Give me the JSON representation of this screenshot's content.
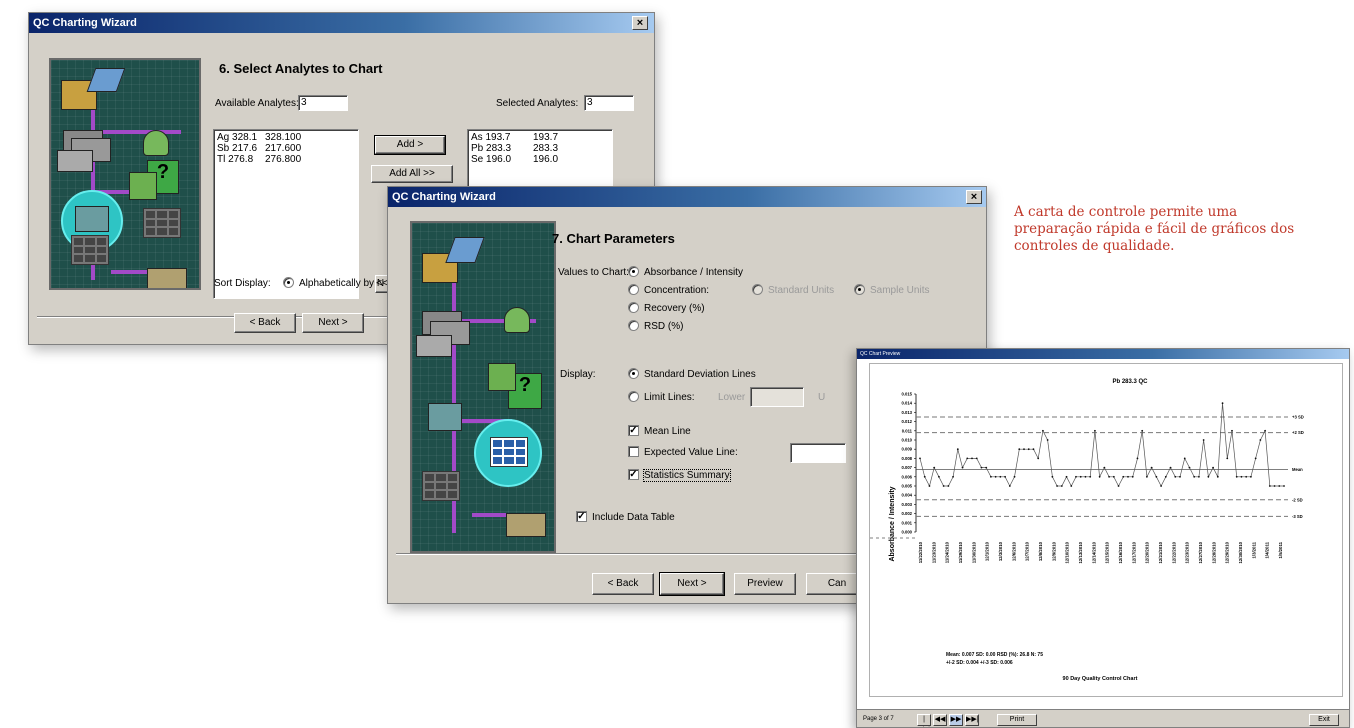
{
  "caption": "A carta de controle permite uma preparação rápida e fácil de gráficos dos controles de qualidade.",
  "wizard1": {
    "title": "QC Charting Wizard",
    "close": "×",
    "heading": "6. Select Analytes to Chart",
    "available_label": "Available Analytes:",
    "available_count": "3",
    "selected_label": "Selected Analytes:",
    "selected_count": "3",
    "available": [
      {
        "name": "Ag 328.1",
        "value": "328.100"
      },
      {
        "name": "Sb 217.6",
        "value": "217.600"
      },
      {
        "name": "Tl 276.8",
        "value": "276.800"
      }
    ],
    "selected": [
      {
        "name": "As 193.7",
        "value": "193.7"
      },
      {
        "name": "Pb 283.3",
        "value": "283.3"
      },
      {
        "name": "Se 196.0",
        "value": "196.0"
      }
    ],
    "add": "Add >",
    "add_all": "Add All >>",
    "remove_partial": "<<",
    "sort_label": "Sort Display:",
    "sort_option": "Alphabetically by N",
    "back": "< Back",
    "next": "Next >"
  },
  "wizard2": {
    "title": "QC Charting Wizard",
    "close": "×",
    "heading": "7. Chart Parameters",
    "values_label": "Values to Chart:",
    "opt_absorbance": "Absorbance / Intensity",
    "opt_concentration": "Concentration:",
    "opt_standard_units": "Standard Units",
    "opt_sample_units": "Sample Units",
    "opt_recovery": "Recovery (%)",
    "opt_rsd": "RSD (%)",
    "display_label": "Display:",
    "opt_std_dev": "Standard Deviation Lines",
    "opt_limit": "Limit Lines:",
    "lower": "Lower",
    "upper_partial": "U",
    "mean_line": "Mean Line",
    "expected_value": "Expected Value Line:",
    "stats_summary": "Statistics Summary",
    "include_table": "Include Data Table",
    "back": "< Back",
    "next": "Next >",
    "preview": "Preview",
    "cancel_partial": "Can"
  },
  "chart_preview": {
    "window_title": "QC Chart Preview",
    "page": "Page 3 of 7",
    "print": "Print",
    "exit": "Exit",
    "nav": [
      "|◀◀",
      "◀◀",
      "▶▶",
      "▶▶|"
    ]
  },
  "chart_data": {
    "type": "line",
    "title": "Pb 283.3  QC",
    "ylabel": "Absorbance / Intensity",
    "xlabel": "",
    "ylim": [
      0,
      0.015
    ],
    "yticks": [
      "0.015",
      "0.014",
      "0.013",
      "0.012",
      "0.011",
      "0.010",
      "0.009",
      "0.008",
      "0.007",
      "0.006",
      "0.005",
      "0.004",
      "0.003",
      "0.002",
      "0.001",
      "0.000"
    ],
    "reference_lines": [
      {
        "label": "+3 SD",
        "value": 0.0125
      },
      {
        "label": "+2 SD",
        "value": 0.0108
      },
      {
        "label": "Mean",
        "value": 0.0068
      },
      {
        "label": "-2 SD",
        "value": 0.0035
      },
      {
        "label": "-3 SD",
        "value": 0.0017
      }
    ],
    "x_labels": [
      "11/22/2010",
      "11/23/2010",
      "11/24/2010",
      "11/29/2010",
      "11/30/2010",
      "12/1/2010",
      "12/3/2010",
      "12/6/2010",
      "12/7/2010",
      "12/8/2010",
      "12/9/2010",
      "12/10/2010",
      "12/13/2010",
      "12/14/2010",
      "12/15/2010",
      "12/16/2010",
      "12/17/2010",
      "12/20/2010",
      "12/21/2010",
      "12/22/2010",
      "12/23/2010",
      "12/27/2010",
      "12/28/2010",
      "12/29/2010",
      "12/30/2010",
      "1/3/2011",
      "1/4/2011",
      "1/5/2011"
    ],
    "values": [
      0.008,
      0.006,
      0.005,
      0.007,
      0.006,
      0.005,
      0.005,
      0.006,
      0.009,
      0.007,
      0.008,
      0.008,
      0.008,
      0.007,
      0.007,
      0.006,
      0.006,
      0.006,
      0.006,
      0.005,
      0.006,
      0.009,
      0.009,
      0.009,
      0.009,
      0.008,
      0.011,
      0.01,
      0.006,
      0.005,
      0.005,
      0.006,
      0.005,
      0.006,
      0.006,
      0.006,
      0.006,
      0.011,
      0.006,
      0.007,
      0.006,
      0.006,
      0.005,
      0.006,
      0.006,
      0.006,
      0.008,
      0.011,
      0.006,
      0.007,
      0.006,
      0.005,
      0.006,
      0.007,
      0.006,
      0.006,
      0.008,
      0.007,
      0.006,
      0.006,
      0.01,
      0.006,
      0.007,
      0.006,
      0.014,
      0.008,
      0.011,
      0.006,
      0.006,
      0.006,
      0.006,
      0.008,
      0.01,
      0.011,
      0.005,
      0.005,
      0.005,
      0.005
    ],
    "stats_line1": "Mean: 0.007   SD: 0.00   RSD (%): 26.8   N: 75",
    "stats_line2": "+/-2 SD: 0.004   +/-3 SD: 0.006",
    "footer_title": "90 Day Quality Control Chart"
  }
}
